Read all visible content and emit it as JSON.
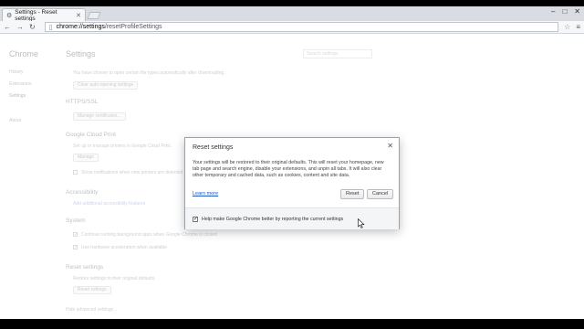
{
  "tab": {
    "title": "Settings - Reset settings",
    "icon": "gear-icon"
  },
  "address_bar": {
    "host": "chrome://settings",
    "path": "/resetProfileSettings"
  },
  "sidebar": {
    "title": "Chrome",
    "items": [
      {
        "label": "History"
      },
      {
        "label": "Extensions"
      },
      {
        "label": "Settings"
      },
      {
        "label": "About"
      }
    ]
  },
  "main": {
    "title": "Settings",
    "search_placeholder": "Search settings",
    "downloads_text": "You have chosen to open certain file types automatically after downloading.",
    "clear_auto_open": "Clear auto-opening settings",
    "https_heading": "HTTPS/SSL",
    "manage_certificates": "Manage certificates...",
    "cloud_print_heading": "Google Cloud Print",
    "cloud_print_text": "Set up or manage printers in Google Cloud Print.",
    "cloud_print_learn": "Learn more",
    "manage_button": "Manage",
    "notifications_text": "Show notifications when new printers are detected on the network",
    "accessibility_heading": "Accessibility",
    "accessibility_link": "Add additional accessibility features",
    "system_heading": "System",
    "background_apps_text": "Continue running background apps when Google Chrome is closed",
    "hardware_accel_text": "Use hardware acceleration when available",
    "reset_heading": "Reset settings",
    "reset_text": "Restore settings to their original defaults.",
    "reset_button": "Reset settings",
    "hide_advanced": "Hide advanced settings..."
  },
  "dialog": {
    "title": "Reset settings",
    "body": "Your settings will be restored to their original defaults. This will reset your homepage, new tab page and search engine, disable your extensions, and unpin all tabs. It will also clear other temporary and cached data, such as cookies, content and site data.",
    "learn_more": "Learn more",
    "reset_label": "Reset",
    "cancel_label": "Cancel",
    "report_label": "Help make Google Chrome better by reporting the current settings",
    "report_checked": true
  }
}
